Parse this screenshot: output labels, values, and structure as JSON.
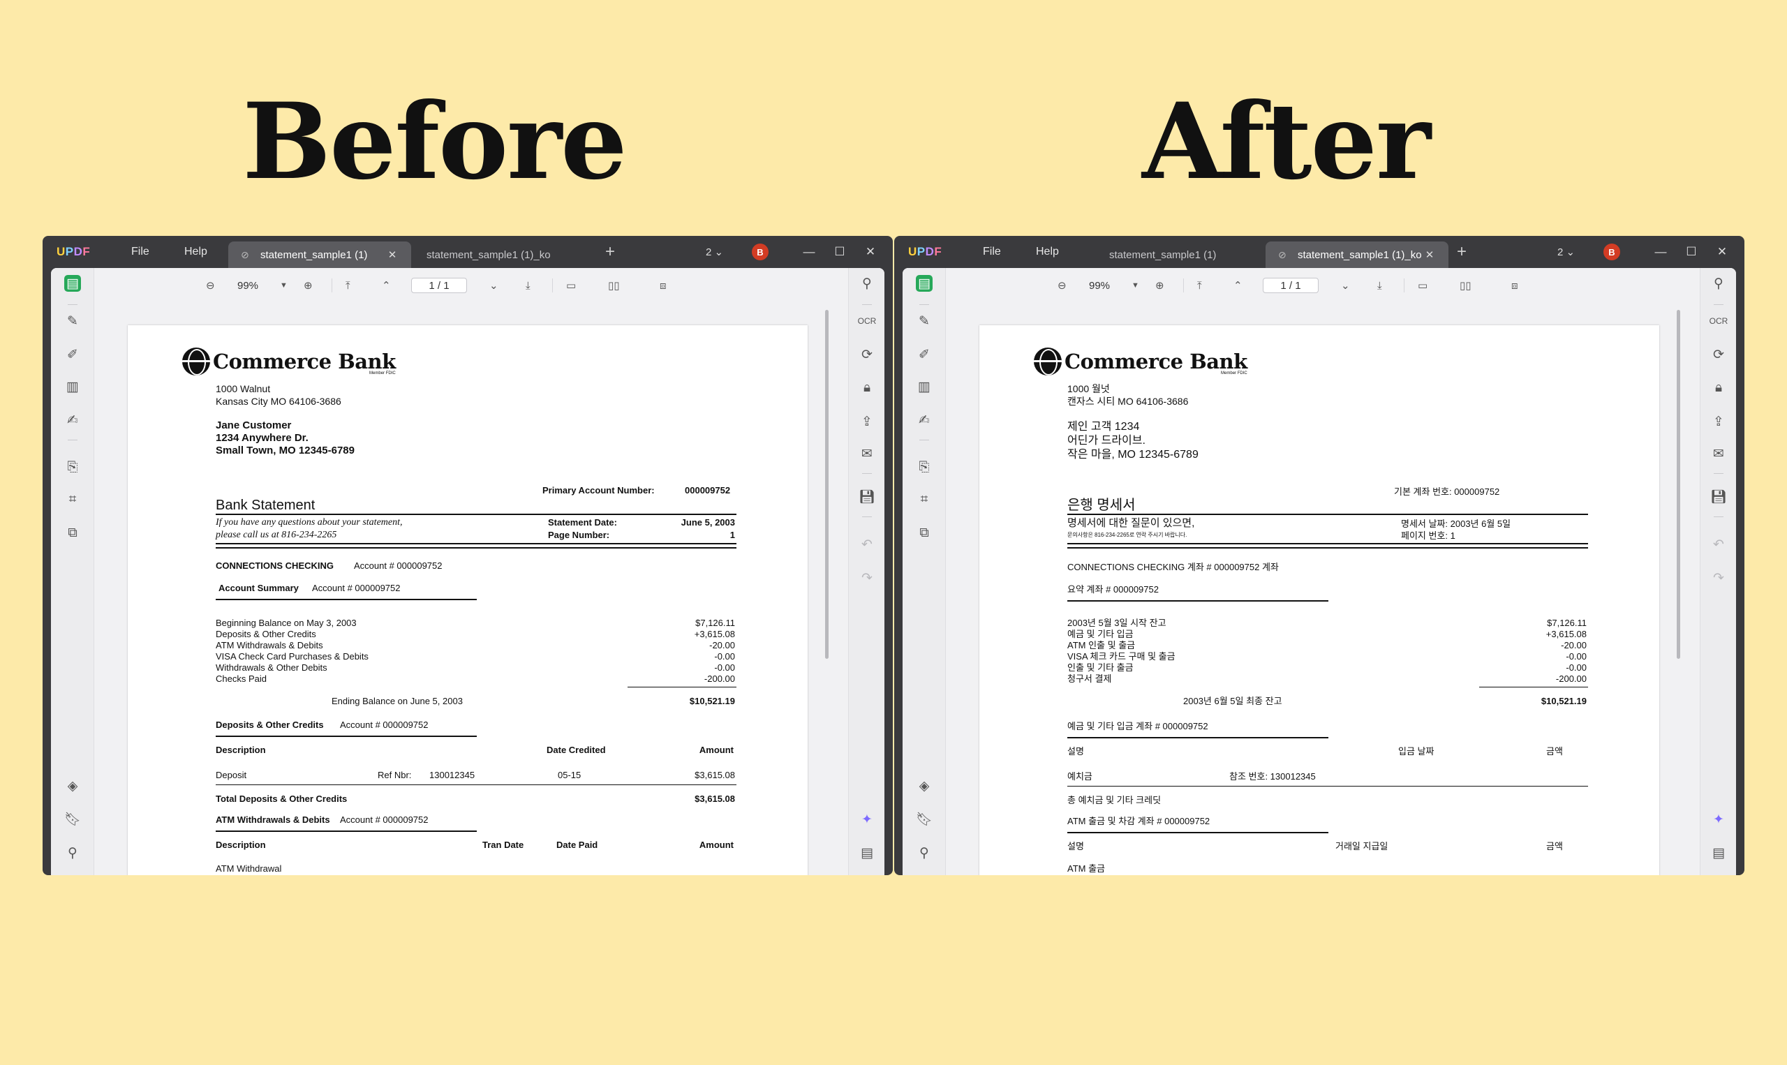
{
  "headings": {
    "before": "Before",
    "after": "After"
  },
  "app": {
    "logo": "UPDF",
    "menu": {
      "file": "File",
      "help": "Help"
    },
    "tabs": [
      "statement_sample1 (1)",
      "statement_sample1 (1)_ko"
    ],
    "tab_count": "2",
    "avatar": "B",
    "zoom": "99%",
    "page": "1 / 1"
  },
  "colors": {
    "background": "#fdeaa9",
    "window": "#3a3a3d",
    "accent": "#26a859",
    "avatar": "#d23c24"
  },
  "icons": {
    "left_sidebar": [
      "reader-icon",
      "comment-icon",
      "edit-text-icon",
      "organize-pages-icon",
      "fill-sign-icon",
      "convert-icon",
      "crop-icon",
      "compress-icon",
      "layers-icon",
      "bookmark-icon",
      "attachment-icon"
    ],
    "right_sidebar": [
      "search-icon",
      "ocr-icon",
      "convert-pdf-icon",
      "protect-icon",
      "share-icon",
      "email-icon",
      "save-icon",
      "undo-icon",
      "redo-icon",
      "ai-assistant-icon",
      "comment-list-icon"
    ]
  },
  "before": {
    "bank": "Commerce Bank",
    "fdic": "Member FDIC",
    "addr1": "1000 Walnut",
    "addr2": "Kansas City MO 64106-3686",
    "cust1": "Jane Customer",
    "cust2": "1234 Anywhere Dr.",
    "cust3": "Small Town, MO 12345-6789",
    "primary_label": "Primary Account Number:",
    "primary_value": "000009752",
    "stmt_title": "Bank Statement",
    "question1": "If you have any questions about your statement,",
    "question2": "please call us at 816-234-2265",
    "stmt_date_label": "Statement Date:",
    "stmt_date_value": "June 5, 2003",
    "page_num_label": "Page Number:",
    "page_num_value": "1",
    "checking_label": "CONNECTIONS CHECKING",
    "checking_acct": "Account # 000009752",
    "summary_label": "Account Summary",
    "summary_acct": "Account # 000009752",
    "summary_rows": [
      {
        "label": "Beginning Balance on May 3, 2003",
        "value": "$7,126.11"
      },
      {
        "label": "Deposits & Other Credits",
        "value": "+3,615.08"
      },
      {
        "label": "ATM Withdrawals & Debits",
        "value": "-20.00"
      },
      {
        "label": "VISA Check Card Purchases & Debits",
        "value": "-0.00"
      },
      {
        "label": "Withdrawals & Other Debits",
        "value": "-0.00"
      },
      {
        "label": "Checks Paid",
        "value": "-200.00"
      }
    ],
    "ending_label": "Ending Balance on June 5, 2003",
    "ending_value": "$10,521.19",
    "deposits_label": "Deposits & Other Credits",
    "deposits_acct": "Account # 000009752",
    "col_description": "Description",
    "col_date_credited": "Date Credited",
    "col_amount": "Amount",
    "deposit_desc": "Deposit",
    "deposit_ref_label": "Ref Nbr:",
    "deposit_ref": "130012345",
    "deposit_date": "05-15",
    "deposit_amount": "$3,615.08",
    "total_deposits_label": "Total Deposits & Other Credits",
    "total_deposits_value": "$3,615.08",
    "atm_label": "ATM Withdrawals & Debits",
    "atm_acct": "Account # 000009752",
    "col_description2": "Description",
    "col_tran_date": "Tran Date",
    "col_date_paid": "Date Paid",
    "col_amount2": "Amount",
    "atm_row": "ATM Withdrawal"
  },
  "after": {
    "bank": "Commerce Bank",
    "fdic": "Member FDIC",
    "addr1": "1000 월넛",
    "addr2": "캔자스 시티 MO 64106-3686",
    "cust1": "제인 고객 1234",
    "cust2": "어딘가 드라이브.",
    "cust3": "작은 마을, MO 12345-6789",
    "primary": "기본 계좌 번호: 000009752",
    "stmt_title": "은행 명세서",
    "question1": "명세서에 대한 질문이 있으면,",
    "question2": "문의사항은 816-234-2265로 연락 주시기 바랍니다.",
    "stmt_date": "명세서 날짜: 2003년 6월 5일",
    "page_num": "페이지 번호: 1",
    "checking": "CONNECTIONS CHECKING 계좌 # 000009752 계좌",
    "summary": "요약 계좌 # 000009752",
    "summary_rows": [
      {
        "label": "2003년 5월 3일 시작 잔고",
        "value": "$7,126.11"
      },
      {
        "label": "예금 및 기타 입금",
        "value": "+3,615.08"
      },
      {
        "label": "ATM 인출 및 출금",
        "value": "-20.00"
      },
      {
        "label": "VISA 체크 카드 구매 및 출금",
        "value": "-0.00"
      },
      {
        "label": "인출 및 기타 출금",
        "value": "-0.00"
      },
      {
        "label": "청구서 결제",
        "value": "-200.00"
      }
    ],
    "ending_label": "2003년 6월 5일 최종 잔고",
    "ending_value": "$10,521.19",
    "deposits": "예금 및 기타 입금 계좌 # 000009752",
    "col_description": "설명",
    "col_date_credited": "입금 날짜",
    "col_amount": "금액",
    "deposit_desc": "예치금",
    "deposit_ref": "참조 번호: 130012345",
    "total_deposits_label": "총 예치금 및 기타 크레딧",
    "atm": "ATM 출금 및 차감 계좌 # 000009752",
    "col_description2": "설명",
    "col_tran_date": "거래일 지급일",
    "col_amount2": "금액",
    "atm_row": "ATM 출금"
  }
}
